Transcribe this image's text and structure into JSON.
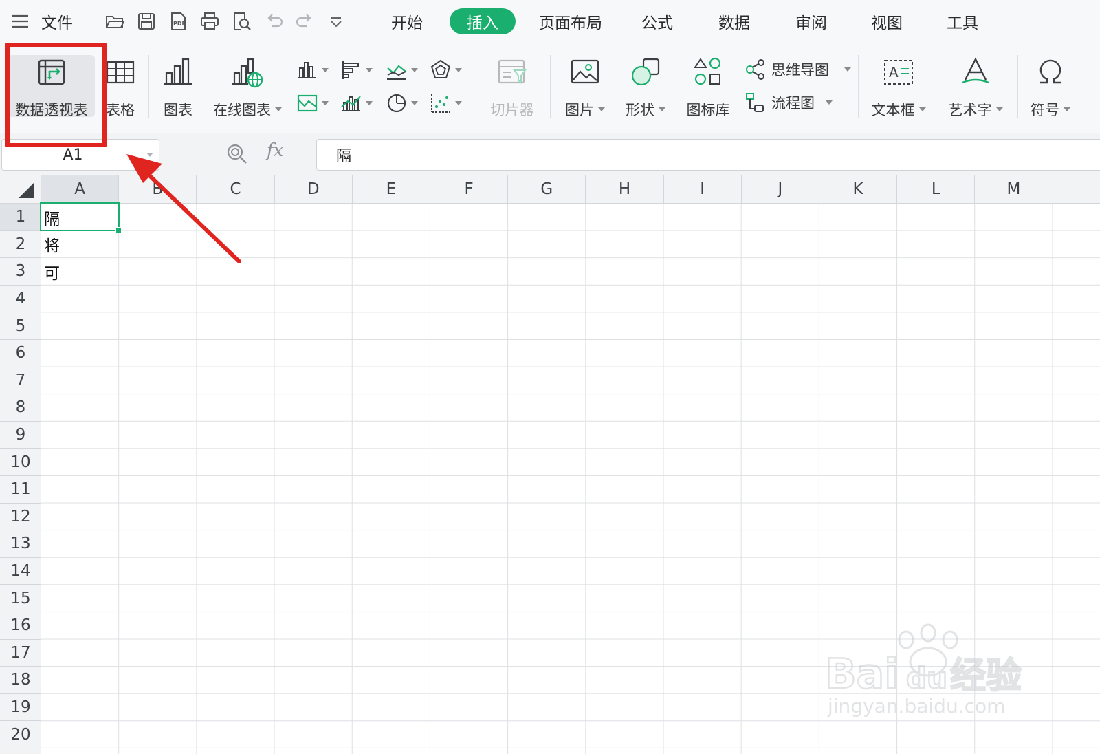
{
  "menubar": {
    "file_label": "文件",
    "tabs": [
      {
        "label": "开始",
        "active": false
      },
      {
        "label": "插入",
        "active": true
      },
      {
        "label": "页面布局",
        "active": false
      },
      {
        "label": "公式",
        "active": false
      },
      {
        "label": "数据",
        "active": false
      },
      {
        "label": "审阅",
        "active": false
      },
      {
        "label": "视图",
        "active": false
      },
      {
        "label": "工具",
        "active": false
      }
    ],
    "quick_access_icons": [
      "open-folder-icon",
      "save-icon",
      "pdf-export-icon",
      "print-icon",
      "print-preview-icon",
      "undo-icon",
      "redo-icon",
      "customize-toolbar-icon"
    ]
  },
  "ribbon": {
    "pivot_table": "数据透视表",
    "table": "表格",
    "chart": "图表",
    "online_chart": "在线图表",
    "slicer": "切片器",
    "picture": "图片",
    "shape": "形状",
    "icon_library": "图标库",
    "mind_map": "思维导图",
    "flowchart": "流程图",
    "text_box": "文本框",
    "word_art": "艺术字",
    "symbol": "符号"
  },
  "formula_bar": {
    "name_box": "A1",
    "formula": "隔"
  },
  "grid": {
    "columns": [
      "A",
      "B",
      "C",
      "D",
      "E",
      "F",
      "G",
      "H",
      "I",
      "J",
      "K",
      "L",
      "M"
    ],
    "rows": [
      "1",
      "2",
      "3",
      "4",
      "5",
      "6",
      "7",
      "8",
      "9",
      "10",
      "11",
      "12",
      "13",
      "14",
      "15",
      "16",
      "17",
      "18",
      "19",
      "20"
    ],
    "cells": [
      {
        "ref": "A1",
        "value": "隔"
      },
      {
        "ref": "A2",
        "value": "将"
      },
      {
        "ref": "A3",
        "value": "可"
      }
    ],
    "selected": "A1"
  },
  "watermark": {
    "brand_text": "Bai",
    "brand_suffix": "经验",
    "url": "jingyan.baidu.com"
  },
  "colors": {
    "accent": "#1aae6f",
    "annotation": "#e02420"
  }
}
